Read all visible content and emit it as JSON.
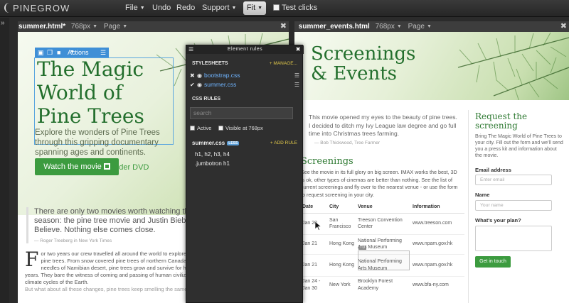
{
  "app": {
    "logo": "PINEGROW"
  },
  "toolbar": {
    "menus": [
      "File",
      "Undo",
      "Redo",
      "Support"
    ],
    "fit_label": "Fit",
    "test_clicks_label": "Test clicks"
  },
  "frames": [
    {
      "file": "summer.html*",
      "size": "768px",
      "page_menu": "Page"
    },
    {
      "file": "summer_events.html",
      "size": "768px",
      "page_menu": "Page"
    }
  ],
  "summer": {
    "actions_label": "Actions",
    "title_lines": [
      "The Magic",
      "World of",
      "Pine Trees"
    ],
    "lead": "Explore the wonders of Pine Trees through this gripping documentary spanning ages and continents.",
    "watch_button": "Watch the movie",
    "dvd_link": "Order DVD",
    "quote": "There are only two movies worth watching this season: the pine tree movie and Justin Bieber's Believe. Nothing else comes close.",
    "quote_cite": "— Roger Treeberg in New York Times",
    "dropcap": "F",
    "story": "or two years our crew travelled all around the world to explore and film pine trees. From snow covered pine trees of northern Canada to silky pine needles of Namibian desert, pine trees grow and survive for hundreds of years. They bare the witness of coming and passing of human civilizations and climate cycles of the Earth.",
    "story_more": "But what about all these changes, pine trees keep smelling the same"
  },
  "events": {
    "title_lines": [
      "Screenings",
      "& Events"
    ],
    "intro": "This movie opened my eyes to the beauty of pine trees. I decided to ditch my Ivy League law degree and go full time into Christmas trees farming.",
    "intro_cite": "— Bob Thickwood, Tree Farmer",
    "screenings_title": "Screenings",
    "screenings_text": "See the movie in its full glory on big screen. IMAX works the best, 3D is ok, other types of cinemas are better than nothing. See the list of current screenings and fly over to the nearest venue - or use the form to request screening in your city.",
    "table": {
      "headers": [
        "Date",
        "City",
        "Venue",
        "Information"
      ],
      "rows": [
        [
          "Jan 20",
          "San Francisco",
          "Treeson Convention Center",
          "www.treeson.com"
        ],
        [
          "Jan 21",
          "Hong Kong",
          "National Performing Arts Museum",
          "www.npam.gov.hk"
        ],
        [
          "Jan 21",
          "Hong Kong",
          "National Performing Arts Museum",
          "www.npam.gov.hk"
        ],
        [
          "Jan 24 - Jan 30",
          "New York",
          "Brooklyn Forest Academy",
          "www.bfa-ny.com"
        ]
      ]
    },
    "hover_tag": "TD",
    "request_title": "Request the screening",
    "request_text": "Bring The Magic World of Pine Trees to your city. Fill out the form and we'll send you a press kit and information about the movie.",
    "email_label": "Email address",
    "email_placeholder": "Enter email",
    "name_label": "Name",
    "name_placeholder": "Your name",
    "plan_label": "What's your plan?",
    "submit": "Get in touch"
  },
  "panel": {
    "title": "Element rules",
    "stylesheets_label": "STYLESHEETS",
    "manage_label": "+ MANAGE...",
    "sheets": [
      "bootstrap.css",
      "summer.css"
    ],
    "css_rules_label": "CSS RULES",
    "search_placeholder": "search",
    "active_label": "Active",
    "visible_label": "Visible at 768px",
    "css_file": "summer.css",
    "less_badge": "LESS",
    "add_rule": "+ ADD RULE",
    "rules": [
      "h1, h2, h3, h4",
      ".jumbotron h1"
    ]
  },
  "colors": {
    "accent_green": "#3c9b3f",
    "title_green": "#236f2d",
    "selection_blue": "#3f8fd6",
    "panel_link": "#6fb4ff",
    "panel_action": "#e1c84a"
  },
  "icons": [
    "hamburger-icon",
    "close-icon",
    "eye-icon",
    "checkmark-icon",
    "film-icon",
    "caret-down-icon",
    "copy-icon",
    "mouse-cursor-icon"
  ]
}
